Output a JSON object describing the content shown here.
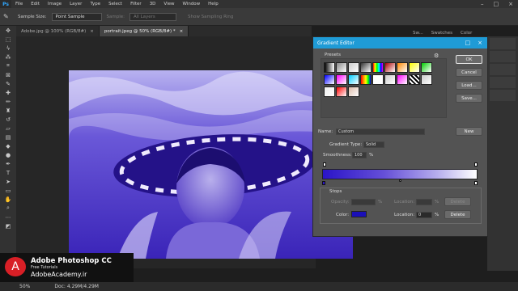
{
  "menu": {
    "logo": "Ps",
    "items": [
      "File",
      "Edit",
      "Image",
      "Layer",
      "Type",
      "Select",
      "Filter",
      "3D",
      "View",
      "Window",
      "Help"
    ]
  },
  "options_bar": {
    "sample_size_label": "Sample Size:",
    "sample_size_value": "Point Sample",
    "sample_label": "Sample:",
    "sample_value": "All Layers",
    "show_ring_label": "Show Sampling Ring"
  },
  "doc_tabs": [
    {
      "label": "Adobe.jpg @ 100% (RGB/8#)",
      "close": "×"
    },
    {
      "label": "portrait.jpeg @ 50% (RGB/8#) *",
      "close": "×"
    }
  ],
  "panel_tabs": [
    "Sw...",
    "Swatches",
    "Color"
  ],
  "dialog": {
    "title": "Gradient Editor",
    "presets_label": "Presets",
    "ok": "OK",
    "cancel": "Cancel",
    "load": "Load...",
    "save": "Save...",
    "name_label": "Name:",
    "name_value": "Custom",
    "new": "New",
    "gradient_type_label": "Gradient Type:",
    "gradient_type_value": "Solid",
    "smoothness_label": "Smoothness:",
    "smoothness_value": "100",
    "smoothness_unit": "%",
    "stops_label": "Stops",
    "opacity_label": "Opacity:",
    "opacity_unit": "%",
    "location_label": "Location:",
    "location_unit": "%",
    "delete": "Delete",
    "color_label": "Color:",
    "location2_label": "Location:",
    "location2_value": "0",
    "location2_unit": "%",
    "delete2": "Delete",
    "presets": [
      "#000000",
      "#888888",
      "#cccccc",
      "#333333",
      "#ff0000",
      "#aa0000",
      "#ff8800",
      "#ffff00",
      "#00cc00",
      "#0000ff",
      "#ff00ff",
      "#00ccff",
      "#ff8800",
      "#ffffff",
      "#cccccc",
      "#ff00ff",
      "#00ff00",
      "#cccccc",
      "#eeeeee",
      "#ff0000",
      "#ddbbaa"
    ]
  },
  "brand": {
    "icon": "A",
    "title": "Adobe Photoshop CC",
    "subtitle": "Free Tutorials",
    "site": "AdobeAcademy.ir"
  },
  "status": {
    "zoom": "50%",
    "doc": "Doc: 4.29M/4.29M"
  },
  "colors": {
    "accent": "#1f9bd6",
    "tint": "#4b32c8",
    "brand_red": "#d81f26"
  }
}
